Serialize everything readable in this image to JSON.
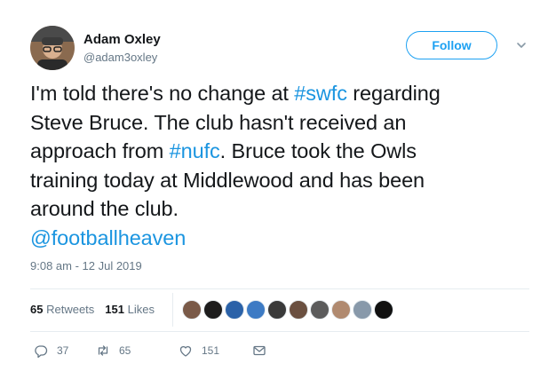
{
  "author": {
    "display_name": "Adam Oxley",
    "handle": "@adam3oxley"
  },
  "follow_label": "Follow",
  "tweet": {
    "lines": [
      [
        {
          "text": "I'm told there's no change at ",
          "link": false
        },
        {
          "text": "#swfc",
          "link": true
        },
        {
          "text": " regarding",
          "link": false
        }
      ],
      [
        {
          "text": "Steve Bruce. The club hasn't received an",
          "link": false
        }
      ],
      [
        {
          "text": "approach from ",
          "link": false
        },
        {
          "text": "#nufc",
          "link": true
        },
        {
          "text": ". Bruce took the Owls",
          "link": false
        }
      ],
      [
        {
          "text": "training today at Middlewood and has been",
          "link": false
        }
      ],
      [
        {
          "text": "around the club.",
          "link": false
        }
      ],
      [
        {
          "text": "@footballheaven",
          "link": true
        }
      ]
    ]
  },
  "timestamp": "9:08 am - 12 Jul 2019",
  "stats": {
    "retweets_count": "65",
    "retweets_label": "Retweets",
    "likes_count": "151",
    "likes_label": "Likes"
  },
  "likers": [
    {
      "name": "liker-avatar-1",
      "color": "#7a5a48"
    },
    {
      "name": "liker-avatar-2",
      "color": "#1d1d1d"
    },
    {
      "name": "liker-avatar-3",
      "color": "#2b62a8"
    },
    {
      "name": "liker-avatar-4",
      "color": "#3d7bc4"
    },
    {
      "name": "liker-avatar-5",
      "color": "#3a3a3a"
    },
    {
      "name": "liker-avatar-6",
      "color": "#6b5040"
    },
    {
      "name": "liker-avatar-7",
      "color": "#5c5c5c"
    },
    {
      "name": "liker-avatar-8",
      "color": "#b08a70"
    },
    {
      "name": "liker-avatar-9",
      "color": "#8899aa"
    },
    {
      "name": "liker-avatar-10",
      "color": "#111111"
    }
  ],
  "actions": {
    "replies": "37",
    "retweets": "65",
    "likes": "151"
  },
  "colors": {
    "link": "#1b95e0",
    "follow_accent": "#1da1f2",
    "muted": "#657786",
    "divider": "#e6ecf0"
  }
}
